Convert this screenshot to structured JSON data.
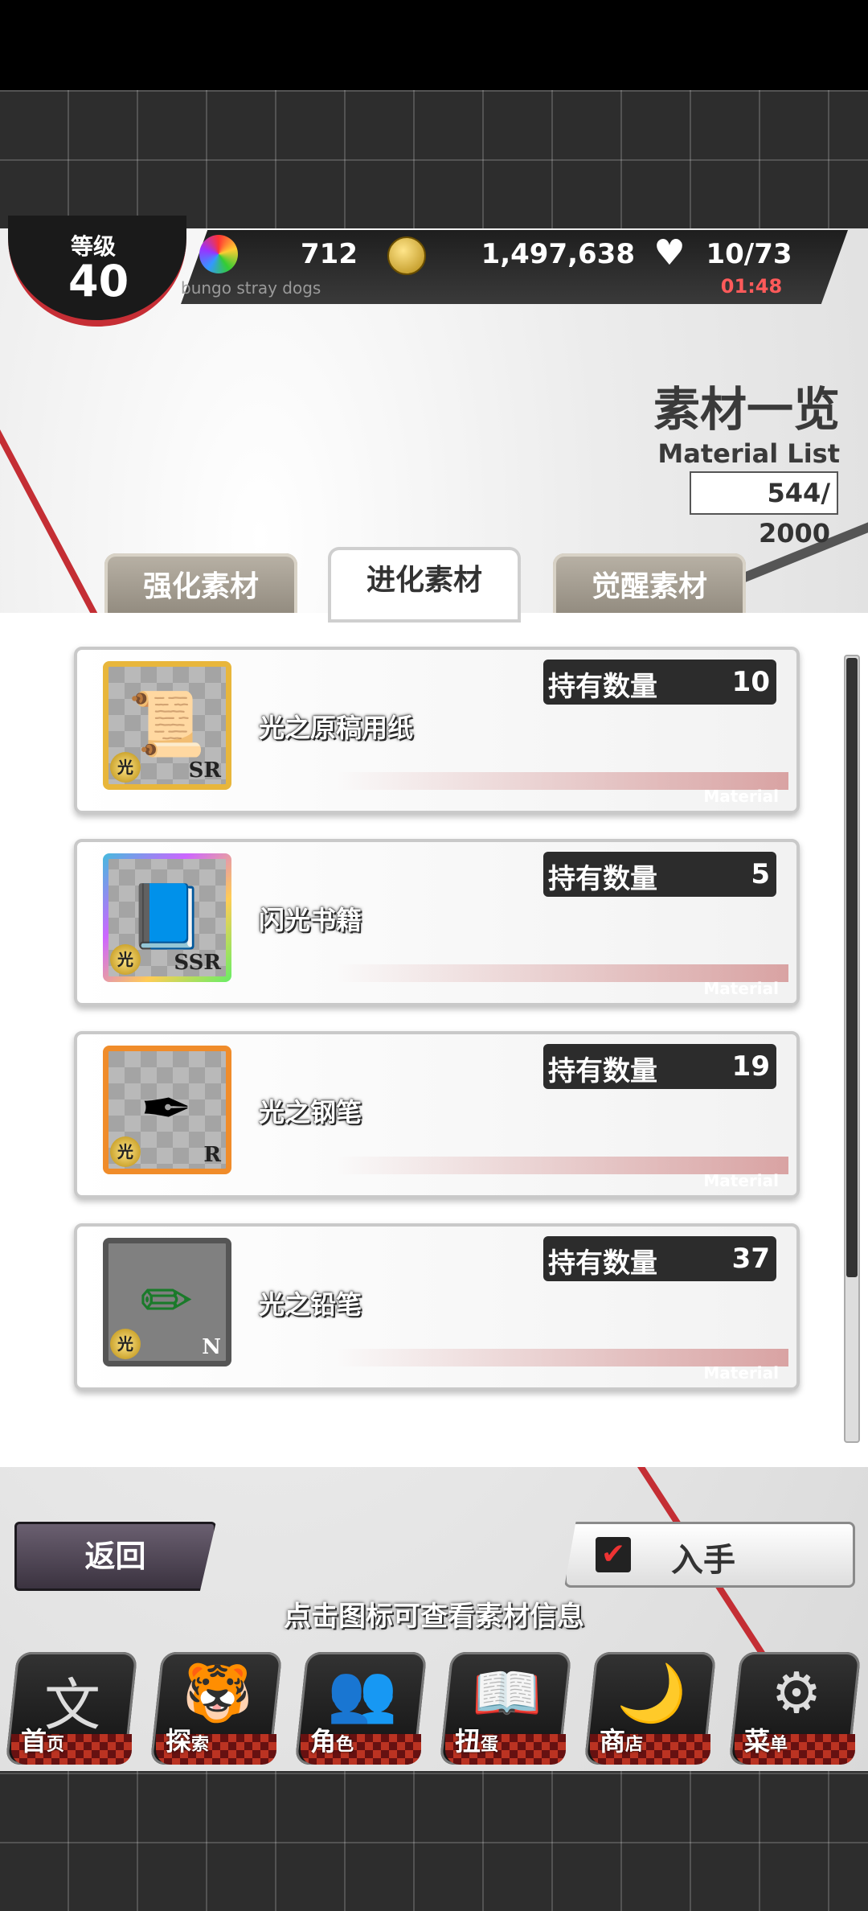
{
  "status": {
    "level_label": "等级",
    "level_value": "40",
    "gems": "712",
    "coins": "1,497,638",
    "ap": "10/73",
    "ap_timer": "01:48",
    "subtitle": "bungo stray dogs"
  },
  "header": {
    "title": "素材一览",
    "subtitle": "Material List",
    "count": "544/ 2000"
  },
  "tabs": [
    {
      "label": "强化素材",
      "active": false
    },
    {
      "label": "进化素材",
      "active": true
    },
    {
      "label": "觉醒素材",
      "active": false
    }
  ],
  "materials": [
    {
      "name": "光之原稿用纸",
      "rarity": "SR",
      "qty_label": "持有数量",
      "qty": "10",
      "tag": "Material",
      "badge": "光",
      "icon": "manuscript-paper-icon"
    },
    {
      "name": "闪光书籍",
      "rarity": "SSR",
      "qty_label": "持有数量",
      "qty": "5",
      "tag": "Material",
      "badge": "光",
      "icon": "book-icon"
    },
    {
      "name": "光之钢笔",
      "rarity": "R",
      "qty_label": "持有数量",
      "qty": "19",
      "tag": "Material",
      "badge": "光",
      "icon": "fountain-pen-icon"
    },
    {
      "name": "光之铅笔",
      "rarity": "N",
      "qty_label": "持有数量",
      "qty": "37",
      "tag": "Material",
      "badge": "光",
      "icon": "pencil-icon"
    }
  ],
  "buttons": {
    "back": "返回",
    "acquire": "入手"
  },
  "hint": "点击图标可查看素材信息",
  "nav": [
    {
      "label": "首",
      "sub": "页",
      "icon": "literary-logo-icon"
    },
    {
      "label": "探",
      "sub": "索",
      "icon": "tiger-icon"
    },
    {
      "label": "角",
      "sub": "色",
      "icon": "characters-icon"
    },
    {
      "label": "扭",
      "sub": "蛋",
      "icon": "gacha-book-icon"
    },
    {
      "label": "商",
      "sub": "店",
      "icon": "rainbow-gem-icon"
    },
    {
      "label": "菜",
      "sub": "单",
      "icon": "gear-icon"
    }
  ]
}
